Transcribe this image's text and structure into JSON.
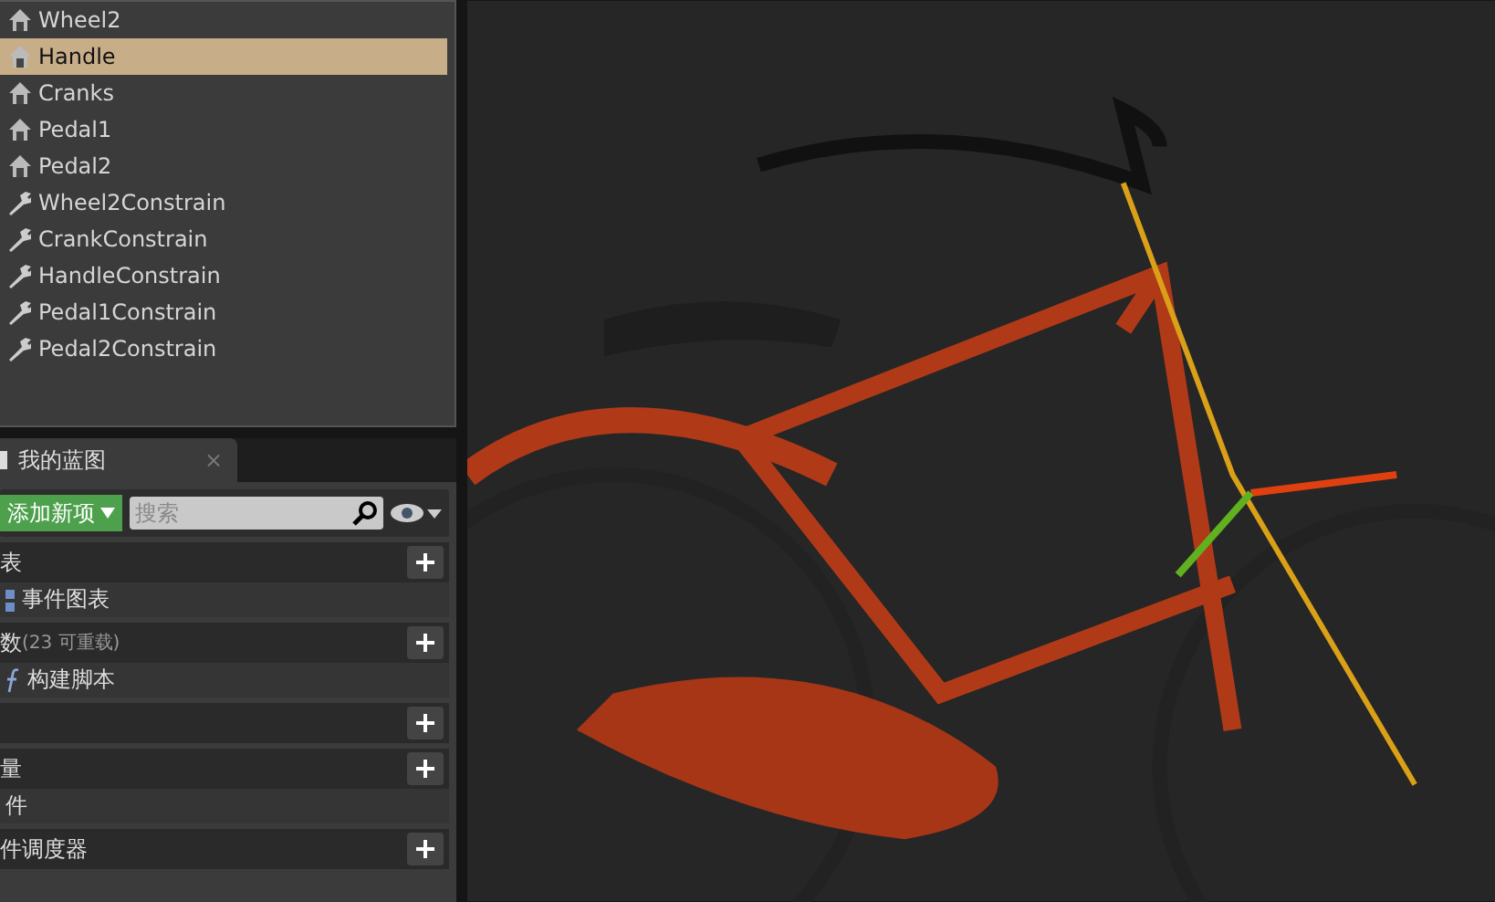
{
  "components": [
    {
      "label": "Wheel2",
      "kind": "mesh",
      "selected": false
    },
    {
      "label": "Handle",
      "kind": "mesh",
      "selected": true
    },
    {
      "label": "Cranks",
      "kind": "mesh",
      "selected": false
    },
    {
      "label": "Pedal1",
      "kind": "mesh",
      "selected": false
    },
    {
      "label": "Pedal2",
      "kind": "mesh",
      "selected": false
    },
    {
      "label": "Wheel2Constrain",
      "kind": "constraint",
      "selected": false
    },
    {
      "label": "CrankConstrain",
      "kind": "constraint",
      "selected": false
    },
    {
      "label": "HandleConstrain",
      "kind": "constraint",
      "selected": false
    },
    {
      "label": "Pedal1Constrain",
      "kind": "constraint",
      "selected": false
    },
    {
      "label": "Pedal2Constrain",
      "kind": "constraint",
      "selected": false
    }
  ],
  "blueprint_tab": {
    "title": "我的蓝图",
    "close": "×"
  },
  "toolbar": {
    "add_button": "添加新项",
    "search": {
      "placeholder": "搜索"
    }
  },
  "sections": [
    {
      "kind": "header",
      "label": "表"
    },
    {
      "kind": "graph",
      "label": "事件图表"
    },
    {
      "kind": "header",
      "label": "数",
      "note": "(23 可重载)"
    },
    {
      "kind": "function",
      "label": "构建脚本"
    },
    {
      "kind": "header"
    },
    {
      "kind": "header",
      "label": "量"
    },
    {
      "kind": "item",
      "label": "件"
    },
    {
      "kind": "header",
      "label": "件调度器"
    }
  ]
}
